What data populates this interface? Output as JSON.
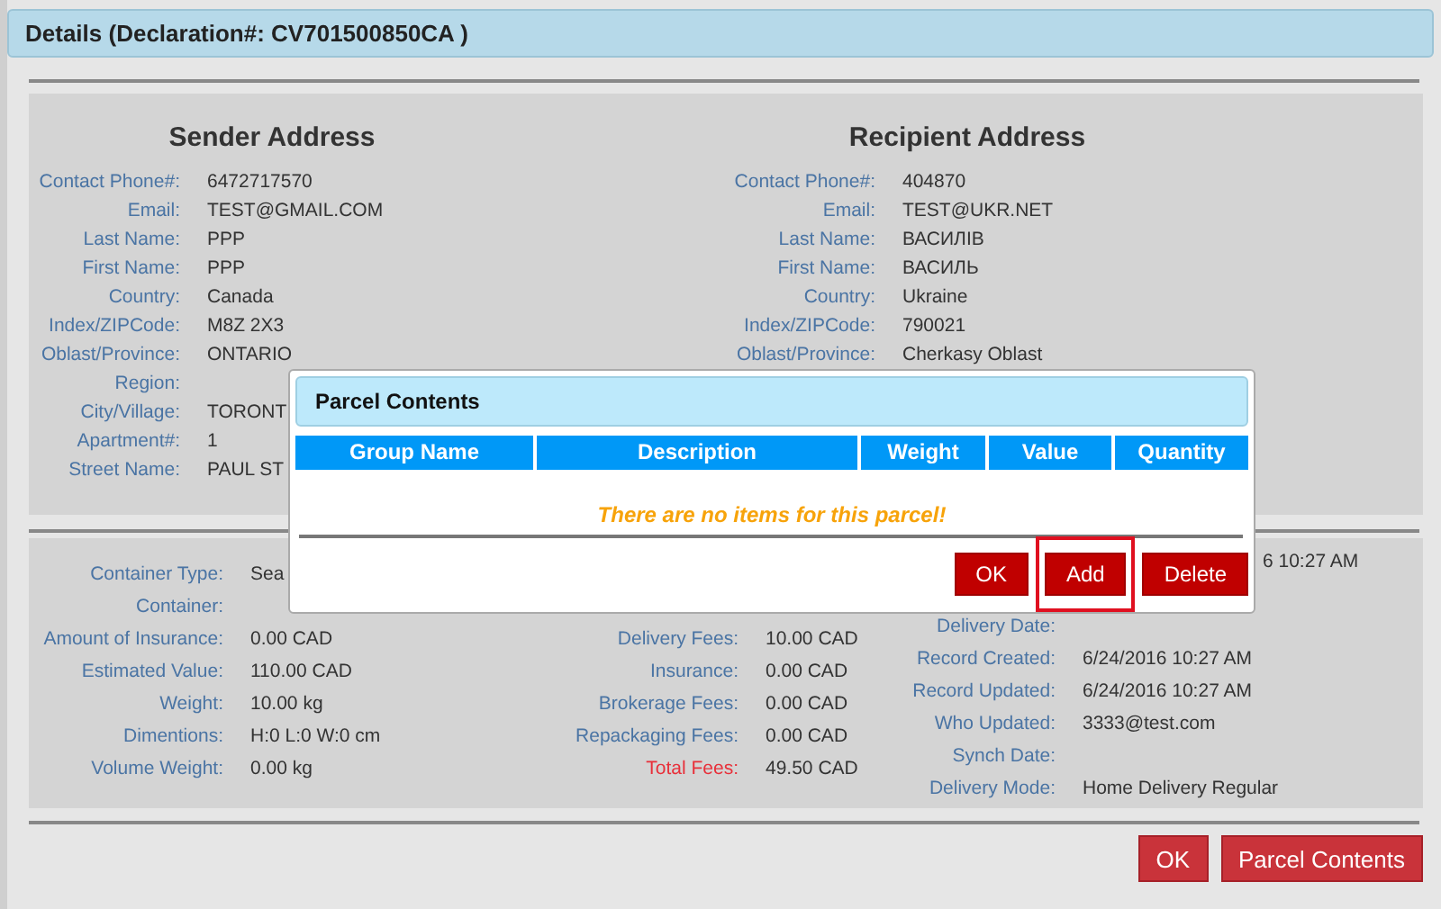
{
  "header": {
    "title": "Details (Declaration#: CV701500850CA )"
  },
  "addresses": [
    {
      "title": "Sender Address",
      "fields": [
        {
          "label": "Contact Phone#:",
          "value": "6472717570"
        },
        {
          "label": "Email:",
          "value": "TEST@GMAIL.COM"
        },
        {
          "label": "Last Name:",
          "value": "PPP"
        },
        {
          "label": "First Name:",
          "value": "PPP"
        },
        {
          "label": "Country:",
          "value": "Canada"
        },
        {
          "label": "Index/ZIPCode:",
          "value": "M8Z 2X3"
        },
        {
          "label": "Oblast/Province:",
          "value": "ONTARIO"
        },
        {
          "label": "Region:"
        },
        {
          "label": "City/Village:",
          "value": "TORONT"
        },
        {
          "label": "Apartment#:",
          "value": "1"
        },
        {
          "label": "Street Name:",
          "value": "PAUL ST"
        }
      ]
    },
    {
      "title": "Recipient Address",
      "fields": [
        {
          "label": "Contact Phone#:",
          "value": "404870"
        },
        {
          "label": "Email:",
          "value": "TEST@UKR.NET"
        },
        {
          "label": "Last Name:",
          "value": "ВАСИЛІВ"
        },
        {
          "label": "First Name:",
          "value": "ВАСИЛЬ"
        },
        {
          "label": "Country:",
          "value": "Ukraine"
        },
        {
          "label": "Index/ZIPCode:",
          "value": "790021"
        },
        {
          "label": "Oblast/Province:",
          "value": "Cherkasy Oblast"
        }
      ]
    }
  ],
  "details": [
    {
      "fields": [
        {
          "label": "Container Type:",
          "value": "Sea"
        },
        {
          "label": "Container:"
        },
        {
          "label": "Amount of Insurance:",
          "value": "0.00 CAD"
        },
        {
          "label": "Estimated Value:",
          "value": "110.00 CAD"
        },
        {
          "label": "Weight:",
          "value": "10.00 kg"
        },
        {
          "label": "Dimentions:",
          "value": "H:0 L:0 W:0 cm"
        },
        {
          "label": "Volume Weight:",
          "value": "0.00 kg"
        }
      ]
    },
    {
      "fields": [
        {
          "label": "Delivery Fees:",
          "value": "10.00 CAD"
        },
        {
          "label": "Insurance:",
          "value": "0.00 CAD"
        },
        {
          "label": "Brokerage Fees:",
          "value": "0.00 CAD"
        },
        {
          "label": "Repackaging Fees:",
          "value": "0.00 CAD"
        }
      ],
      "total": {
        "label": "Total Fees:",
        "value": "49.50 CAD"
      }
    },
    {
      "fields": [
        {
          "value": "6 10:27 AM"
        },
        {
          "label": "Delivery Date:"
        },
        {
          "label": "Record Created:",
          "value": "6/24/2016 10:27 AM"
        },
        {
          "label": "Record Updated:",
          "value": "6/24/2016 10:27 AM"
        },
        {
          "label": "Who Updated:",
          "value": "3333@test.com"
        },
        {
          "label": "Synch Date:"
        },
        {
          "label": "Delivery Mode:",
          "value": "Home Delivery Regular"
        }
      ]
    }
  ],
  "buttons": [
    "OK",
    "Parcel Contents"
  ],
  "modal": {
    "title": "Parcel Contents",
    "columns": [
      "Group Name",
      "Description",
      "Weight",
      "Value",
      "Quantity"
    ],
    "empty_message": "There are no items for this parcel!",
    "buttons": [
      {
        "label": "OK",
        "highlighted": false
      },
      {
        "label": "Add",
        "highlighted": true
      },
      {
        "label": "Delete",
        "highlighted": false
      }
    ]
  }
}
